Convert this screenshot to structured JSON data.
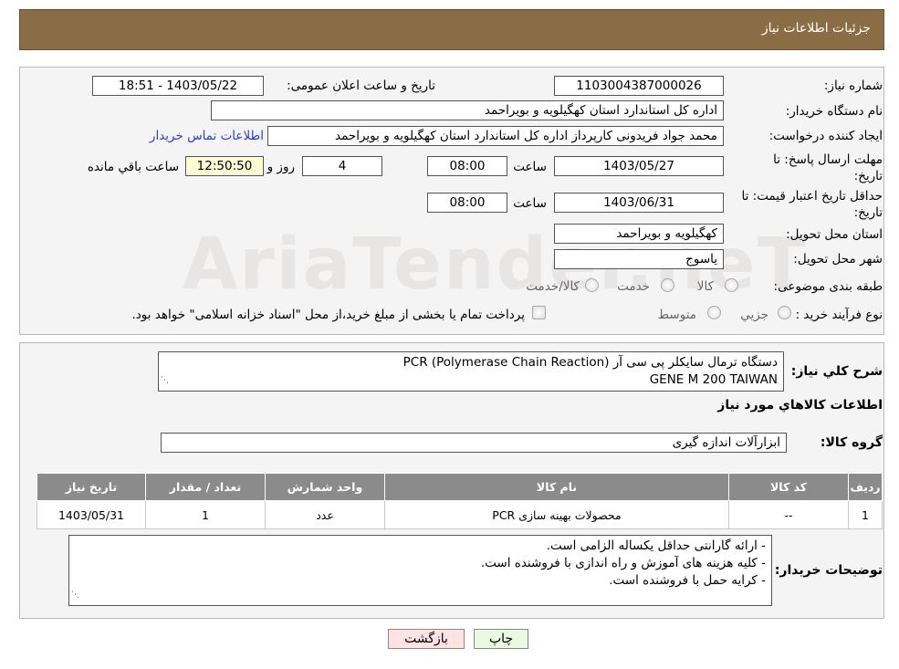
{
  "header": {
    "title": "جزئیات اطلاعات نیاز"
  },
  "watermark": "AriaTender.neT",
  "form": {
    "need_number_label": "شماره نیاز:",
    "need_number": "1103004387000026",
    "announce_label": "تاریخ و ساعت اعلان عمومی:",
    "announce_value": "1403/05/22 - 18:51",
    "buyer_org_label": "نام دستگاه خریدار:",
    "buyer_org": "اداره کل استاندارد استان کهگیلویه و بویراحمد",
    "creator_label": "ایجاد کننده درخواست:",
    "creator": "محمد جواد  فریدونی کارپرداز اداره کل استاندارد استان کهگیلویه و بویراحمد",
    "contact_link": "اطلاعات تماس خریدار",
    "deadline_label": "مهلت ارسال پاسخ: تا تاریخ:",
    "deadline_date": "1403/05/27",
    "time_label": "ساعت",
    "deadline_time": "08:00",
    "days_value": "4",
    "days_label": "روز و",
    "remaining_time": "12:50:50",
    "remaining_label": "ساعت باقي مانده",
    "validity_label": "حداقل تاریخ اعتبار قیمت: تا تاریخ:",
    "validity_date": "1403/06/31",
    "validity_time": "08:00",
    "province_label": "استان محل تحویل:",
    "province": "کهگیلویه و بویراحمد",
    "city_label": "شهر محل تحویل:",
    "city": "یاسوج",
    "category_label": "طبقه بندی موضوعی:",
    "category_options": [
      "کالا",
      "خدمت",
      "کالا/خدمت"
    ],
    "process_label": "نوع فرآیند خرید :",
    "process_options": [
      "جزیي",
      "متوسط"
    ],
    "process_note": "پرداخت تمام یا بخشی از مبلغ خرید،از محل \"اسناد خزانه اسلامی\" خواهد بود."
  },
  "details": {
    "summary_label": "شرح كلي نياز:",
    "summary_line1": "دستگاه ترمال سایکلر پی سی آر (PCR (Polymerase Chain Reaction",
    "summary_line2": "GENE M 200 TAIWAN",
    "goods_info_title": "اطلاعات کالاهاي مورد نياز",
    "goods_group_label": "گروه کالا:",
    "goods_group": "ابزارآلات اندازه گیری",
    "table": {
      "headers": [
        "ردیف",
        "کد کالا",
        "نام کالا",
        "واحد شمارش",
        "تعداد / مقدار",
        "تاریخ نیاز"
      ],
      "rows": [
        [
          "1",
          "--",
          "محصولات بهینه سازی PCR",
          "عدد",
          "1",
          "1403/05/31"
        ]
      ]
    },
    "buyer_notes_label": "توضیحات خریدار:",
    "buyer_notes": [
      "- ارائه گارانتی حداقل یکساله الزامی است.",
      "- کلیه هزینه های آموزش و راه اندازی با فروشنده است.",
      "- کرایه حمل با فروشنده است."
    ]
  },
  "buttons": {
    "print": "چاپ",
    "back": "بازگشت"
  }
}
